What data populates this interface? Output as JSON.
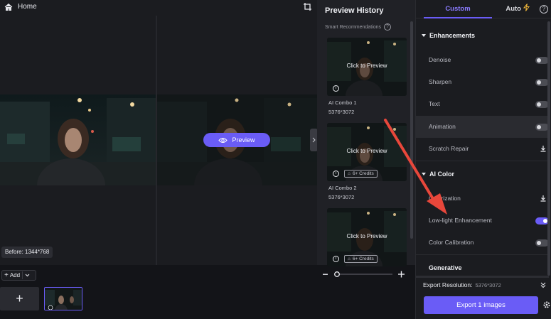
{
  "header": {
    "home_label": "Home"
  },
  "viewer": {
    "preview_label": "Preview",
    "before_size": "Before: 1344*768"
  },
  "toolbar": {
    "add_label": "Add"
  },
  "history": {
    "title": "Preview History",
    "smart_recommendations": "Smart Recommendations",
    "click_to_preview": "Click to Preview",
    "cards": [
      {
        "name": "AI Combo 1",
        "resolution": "5376*3072",
        "credits": ""
      },
      {
        "name": "AI Combo 2",
        "resolution": "5376*3072",
        "credits": "6+ Credits"
      },
      {
        "name": "",
        "resolution": "",
        "credits": "6+ Credits"
      }
    ]
  },
  "settings": {
    "tabs": {
      "custom": "Custom",
      "auto": "Auto"
    },
    "enhancements": {
      "title": "Enhancements",
      "items": [
        {
          "label": "Denoise",
          "control": "toggle",
          "on": false
        },
        {
          "label": "Sharpen",
          "control": "toggle",
          "on": false
        },
        {
          "label": "Text",
          "control": "toggle",
          "on": false
        },
        {
          "label": "Animation",
          "control": "toggle",
          "on": false
        },
        {
          "label": "Scratch Repair",
          "control": "download",
          "on": false
        }
      ]
    },
    "ai_color": {
      "title": "AI Color",
      "items": [
        {
          "label": "Colorization",
          "control": "download",
          "on": false
        },
        {
          "label": "Low-light Enhancement",
          "control": "toggle",
          "on": true
        },
        {
          "label": "Color Calibration",
          "control": "toggle",
          "on": false
        }
      ]
    },
    "generative": {
      "title": "Generative"
    },
    "export": {
      "resolution_label": "Export Resolution:",
      "resolution_value": "5376*3072",
      "button_label": "Export 1 images"
    }
  },
  "colors": {
    "accent": "#6a5cf6",
    "arrow": "#e8473b"
  }
}
